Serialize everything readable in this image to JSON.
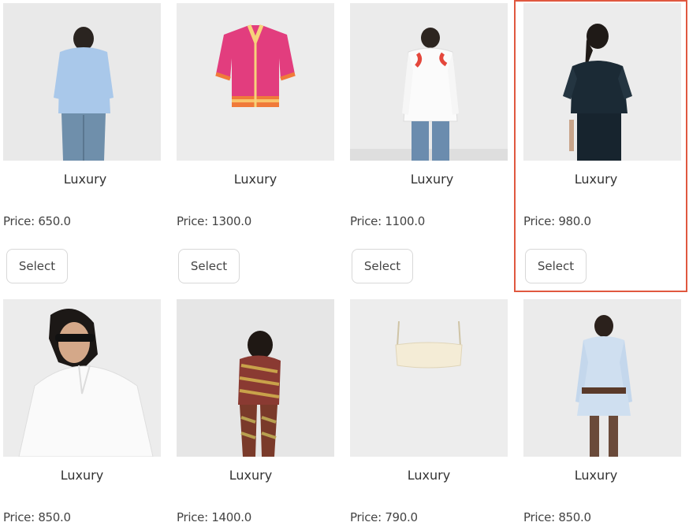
{
  "products": [
    {
      "brand": "Luxury",
      "price": "Price: 650.0",
      "select_label": "Select",
      "image": "woman-blue-shirt-back-view"
    },
    {
      "brand": "Luxury",
      "price": "Price: 1300.0",
      "select_label": "Select",
      "image": "pink-knit-shirt"
    },
    {
      "brand": "Luxury",
      "price": "Price: 1100.0",
      "select_label": "Select",
      "image": "man-white-shirt-back-view"
    },
    {
      "brand": "Luxury",
      "price": "Price: 980.0",
      "select_label": "Select",
      "image": "woman-black-dress-back-view",
      "selected": true
    },
    {
      "brand": "Luxury",
      "price": "Price: 850.0",
      "select_label": "Select",
      "image": "woman-white-shirt-sunglasses"
    },
    {
      "brand": "Luxury",
      "price": "Price: 1400.0",
      "select_label": "Select",
      "image": "woman-striped-set-back-view"
    },
    {
      "brand": "Luxury",
      "price": "Price: 790.0",
      "select_label": "Select",
      "image": "cream-bralette-top"
    },
    {
      "brand": "Luxury",
      "price": "Price: 850.0",
      "select_label": "Select",
      "image": "woman-light-blue-denim-set-back-view"
    }
  ],
  "colors": {
    "highlight": "#e0583f",
    "button_border": "#d8d8d8"
  }
}
